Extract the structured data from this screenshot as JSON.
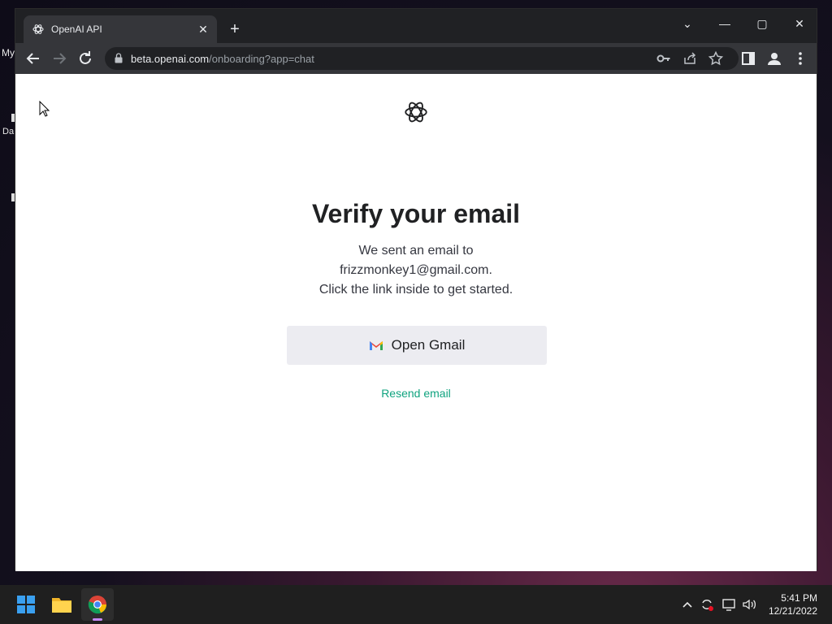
{
  "desktop": {
    "icon_labels": [
      "My",
      "Da"
    ]
  },
  "browser": {
    "tab_title": "OpenAI API",
    "tab_close": "✕",
    "new_tab": "+",
    "controls": {
      "dropdown": "⌄",
      "minimize": "—",
      "maximize": "▢",
      "close": "✕"
    },
    "url_host": "beta.openai.com",
    "url_path": "/onboarding?app=chat"
  },
  "page": {
    "heading": "Verify your email",
    "line1": "We sent an email to",
    "line2": "frizzmonkey1@gmail.com.",
    "line3": "Click the link inside to get started.",
    "open_gmail_label": "Open Gmail",
    "resend_label": "Resend email"
  },
  "taskbar": {
    "time": "5:41 PM",
    "date": "12/21/2022"
  },
  "colors": {
    "accent_green": "#10a37f",
    "button_bg": "#ececf1"
  }
}
